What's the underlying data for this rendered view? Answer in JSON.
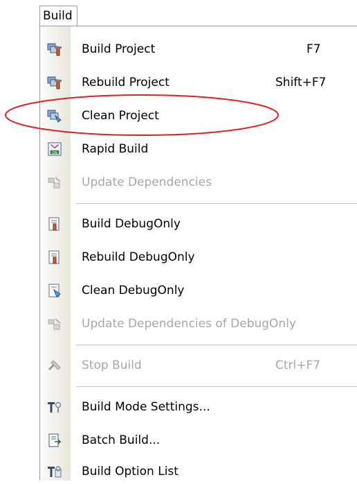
{
  "menubar": {
    "tab_label": "Build"
  },
  "menu": {
    "items": [
      {
        "label": "Build Project",
        "shortcut": "F7",
        "icon": "build-project-icon",
        "enabled": true
      },
      {
        "label": "Rebuild Project",
        "shortcut": "Shift+F7",
        "icon": "rebuild-project-icon",
        "enabled": true
      },
      {
        "label": "Clean Project",
        "shortcut": "",
        "icon": "clean-project-icon",
        "enabled": true
      },
      {
        "label": "Rapid Build",
        "shortcut": "",
        "icon": "rapid-build-icon",
        "enabled": true
      },
      {
        "label": "Update Dependencies",
        "shortcut": "",
        "icon": "update-dependencies-icon",
        "enabled": false
      },
      {
        "label": "Build DebugOnly",
        "shortcut": "",
        "icon": "build-debugonly-icon",
        "enabled": true
      },
      {
        "label": "Rebuild DebugOnly",
        "shortcut": "",
        "icon": "rebuild-debugonly-icon",
        "enabled": true
      },
      {
        "label": "Clean DebugOnly",
        "shortcut": "",
        "icon": "clean-debugonly-icon",
        "enabled": true
      },
      {
        "label": "Update Dependencies of DebugOnly",
        "shortcut": "",
        "icon": "update-dependencies-debugonly-icon",
        "enabled": false
      },
      {
        "label": "Stop Build",
        "shortcut": "Ctrl+F7",
        "icon": "stop-build-icon",
        "enabled": false
      },
      {
        "label": "Build Mode Settings...",
        "shortcut": "",
        "icon": "build-mode-settings-icon",
        "enabled": true
      },
      {
        "label": "Batch Build...",
        "shortcut": "",
        "icon": "batch-build-icon",
        "enabled": true
      },
      {
        "label": "Build Option List",
        "shortcut": "",
        "icon": "build-option-list-icon",
        "enabled": true
      }
    ]
  },
  "highlight": {
    "target": "Clean Project",
    "color": "#e02020"
  }
}
